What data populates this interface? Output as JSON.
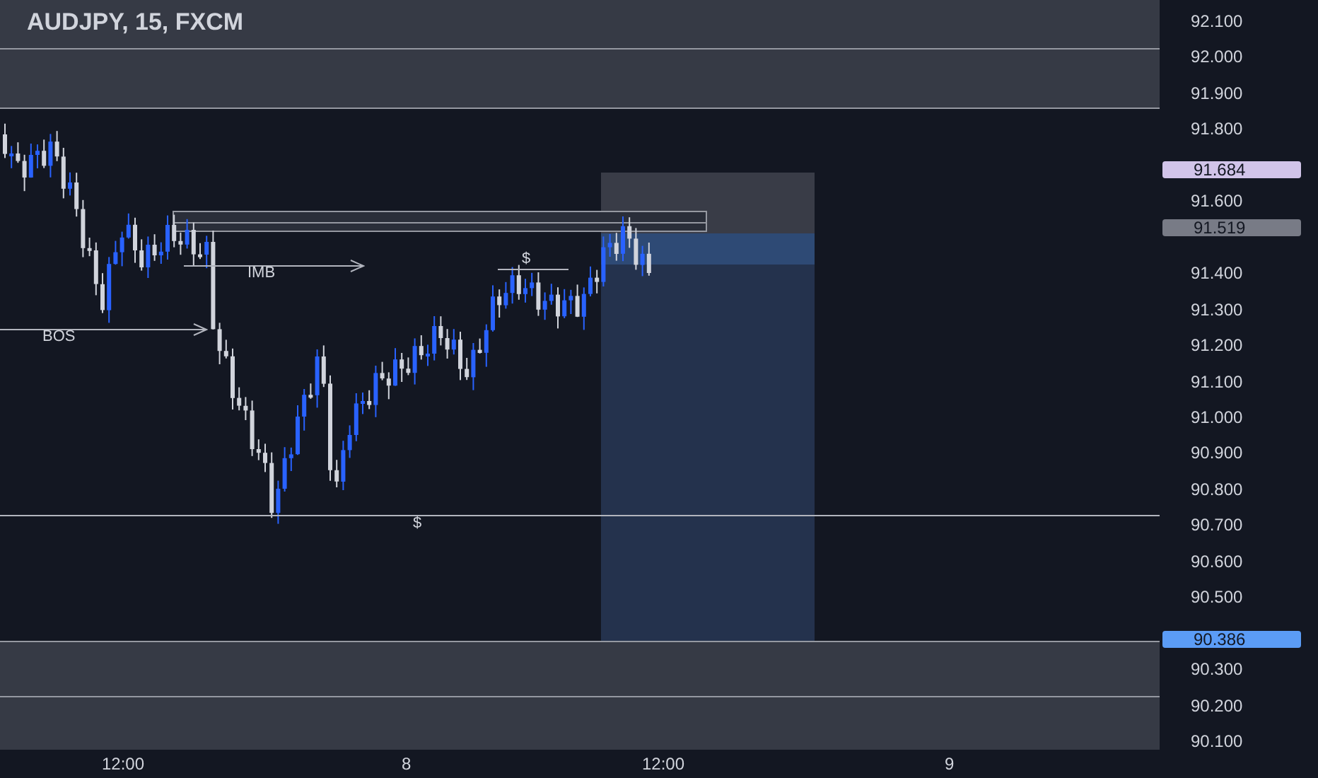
{
  "chart_title": "AUDJPY, 15, FXCM",
  "price_axis": [
    "92.100",
    "92.000",
    "91.900",
    "91.800",
    "91.600",
    "91.400",
    "91.300",
    "91.200",
    "91.100",
    "91.000",
    "90.900",
    "90.800",
    "90.700",
    "90.600",
    "90.500",
    "90.300",
    "90.200",
    "90.100"
  ],
  "price_tags": [
    {
      "text": "91.684",
      "color": "#d1c4e9"
    },
    {
      "text": "91.519",
      "color": "#787b86"
    },
    {
      "text": "90.386",
      "color": "#5b9cf6"
    }
  ],
  "time_axis": [
    "12:00",
    "8",
    "12:00",
    "9"
  ],
  "annotations": [
    {
      "kind": "arrow",
      "text": "IMB"
    },
    {
      "kind": "arrow",
      "text": "BOS"
    },
    {
      "kind": "line",
      "text": "$"
    },
    {
      "kind": "line",
      "text": "$"
    }
  ]
}
